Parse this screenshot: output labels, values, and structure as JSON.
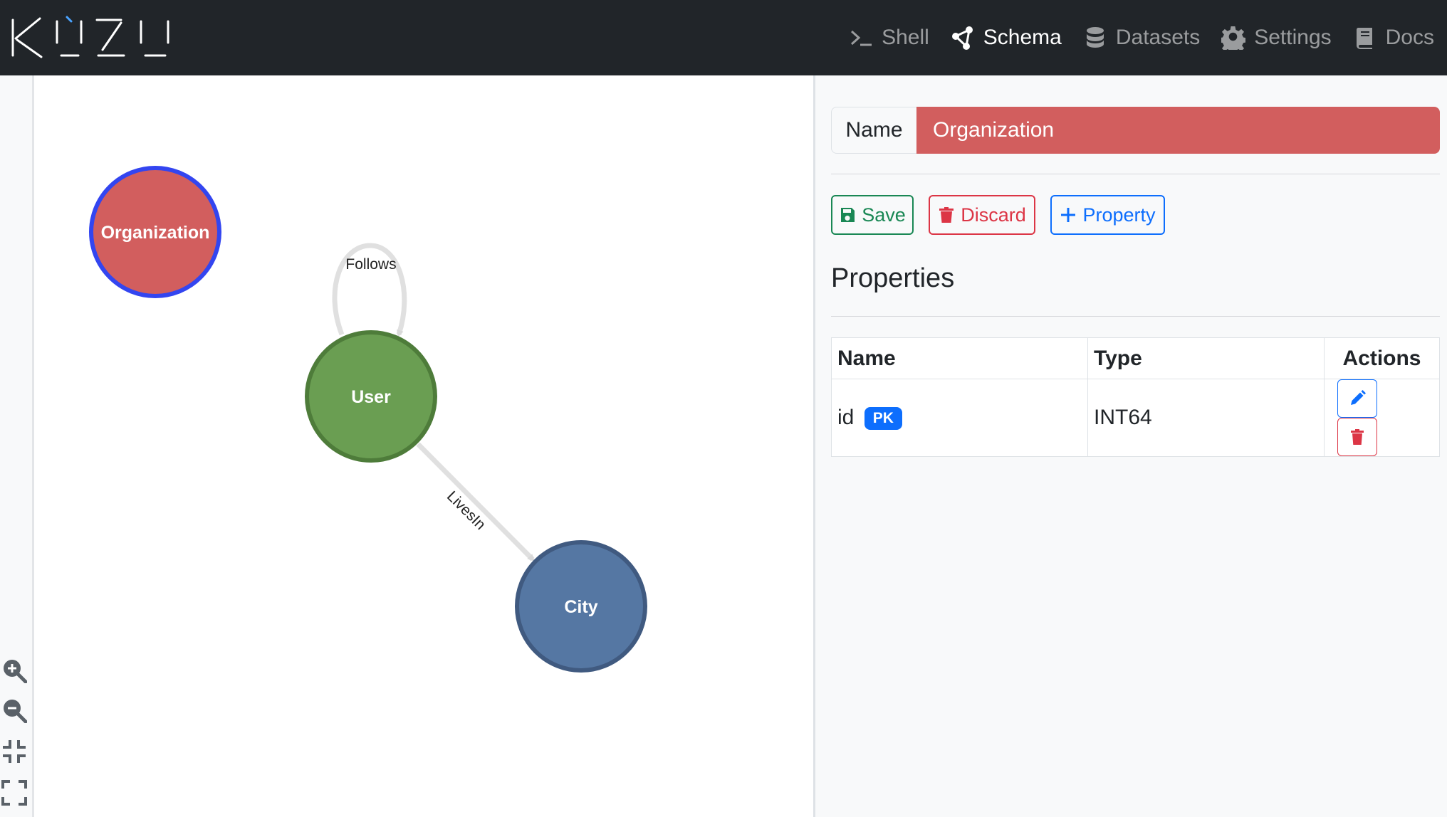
{
  "brand": {
    "logo_text": "KÙZU"
  },
  "nav": [
    {
      "label": "Shell",
      "icon": "terminal-icon",
      "active": false
    },
    {
      "label": "Schema",
      "icon": "share-icon",
      "active": true
    },
    {
      "label": "Datasets",
      "icon": "database-icon",
      "active": false
    },
    {
      "label": "Settings",
      "icon": "gear-icon",
      "active": false
    },
    {
      "label": "Docs",
      "icon": "book-icon",
      "active": false
    }
  ],
  "graph": {
    "nodes": [
      {
        "label": "Organization",
        "color": "#d25e5e",
        "border": "#3345f0",
        "selected": true
      },
      {
        "label": "User",
        "color": "#6a9e52",
        "border": "#4e7c3a",
        "selected": false
      },
      {
        "label": "City",
        "color": "#5577a3",
        "border": "#405a80",
        "selected": false
      }
    ],
    "edges": [
      {
        "label": "Follows",
        "from": "User",
        "to": "User"
      },
      {
        "label": "LivesIn",
        "from": "User",
        "to": "City"
      }
    ],
    "tools": [
      "zoom-in-icon",
      "zoom-out-icon",
      "fit-view-icon",
      "fullscreen-icon"
    ]
  },
  "editor": {
    "name_label": "Name",
    "name_value": "Organization",
    "name_color": "#d25e5e",
    "buttons": {
      "save": "Save",
      "discard": "Discard",
      "property": "Property"
    },
    "properties_title": "Properties",
    "table": {
      "headers": {
        "name": "Name",
        "type": "Type",
        "actions": "Actions"
      },
      "rows": [
        {
          "name": "id",
          "badge": "PK",
          "badge_color": "#0d6efd",
          "type": "INT64"
        }
      ]
    }
  },
  "colors": {
    "navbar": "#212529",
    "edge": "#e0e0e0"
  }
}
